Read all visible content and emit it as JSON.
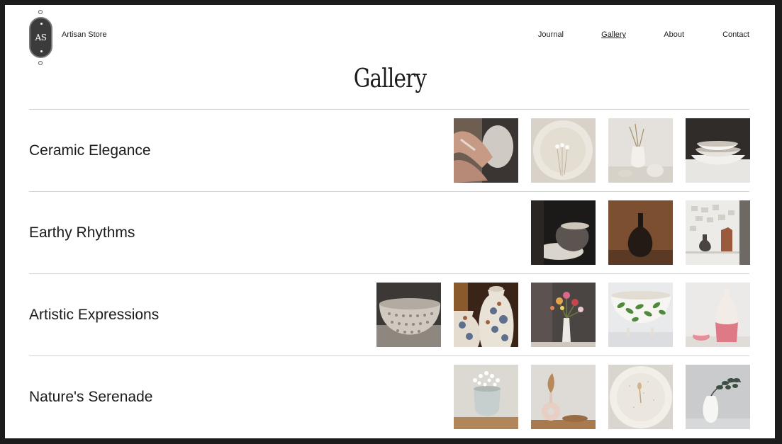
{
  "brand": {
    "logo_text": "AS",
    "name": "Artisan Store"
  },
  "nav": {
    "items": [
      "Journal",
      "Gallery",
      "About",
      "Contact"
    ],
    "active": "Gallery"
  },
  "page": {
    "title": "Gallery"
  },
  "collections": [
    {
      "title": "Ceramic Elegance",
      "images": [
        "pottery-wheel-hands",
        "plate-with-dried-flowers",
        "white-vase-with-stems",
        "stacked-white-bowls"
      ]
    },
    {
      "title": "Earthy Rhythms",
      "images": [
        "dark-cup-on-saucer",
        "black-bud-vase",
        "small-vases-on-shelf"
      ]
    },
    {
      "title": "Artistic Expressions",
      "images": [
        "textured-pattern-bowl",
        "blue-white-ginger-jars",
        "flowers-in-white-vase",
        "leaf-painted-footed-bowl",
        "pink-glazed-vase"
      ]
    },
    {
      "title": "Nature's Serenade",
      "images": [
        "cup-with-babys-breath",
        "ring-vase-with-dried-leaf",
        "speckled-white-plate",
        "white-vase-with-eucalyptus"
      ]
    }
  ],
  "colors": {
    "background": "#ffffff",
    "text": "#1b1b1b",
    "divider": "#d2d2d2",
    "frame": "#1c1c1c",
    "logo_fill": "#3b3b3b"
  }
}
